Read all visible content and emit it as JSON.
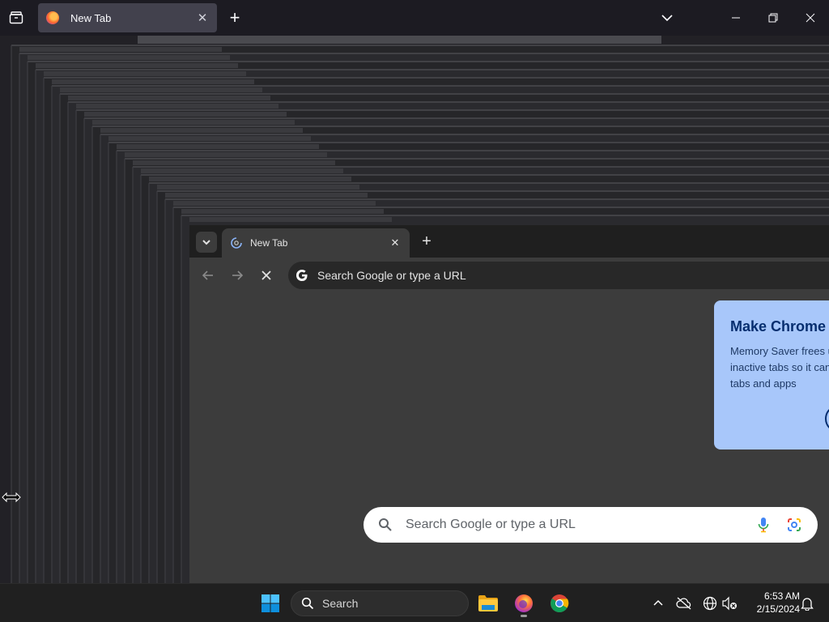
{
  "firefox": {
    "tab_title": "New Tab",
    "tab_close_glyph": "✕",
    "new_tab_glyph": "+"
  },
  "chrome": {
    "tab_title": "New Tab",
    "tab_close_glyph": "✕",
    "new_tab_glyph": "+",
    "omnibox_placeholder": "Search Google or type a URL",
    "promo": {
      "title": "Make Chrome f",
      "body": "Memory Saver frees up memory from inactive tabs so it can be used by other tabs and apps"
    },
    "ntp_search_placeholder": "Search Google or type a URL"
  },
  "taskbar": {
    "search_placeholder": "Search",
    "time": "6:53 AM",
    "date": "2/15/2024"
  },
  "colors": {
    "firefox_bg": "#1c1b22",
    "chrome_bg": "#3c3c3c",
    "promo_bg": "#a8c7fa",
    "taskbar_bg": "#202020"
  }
}
